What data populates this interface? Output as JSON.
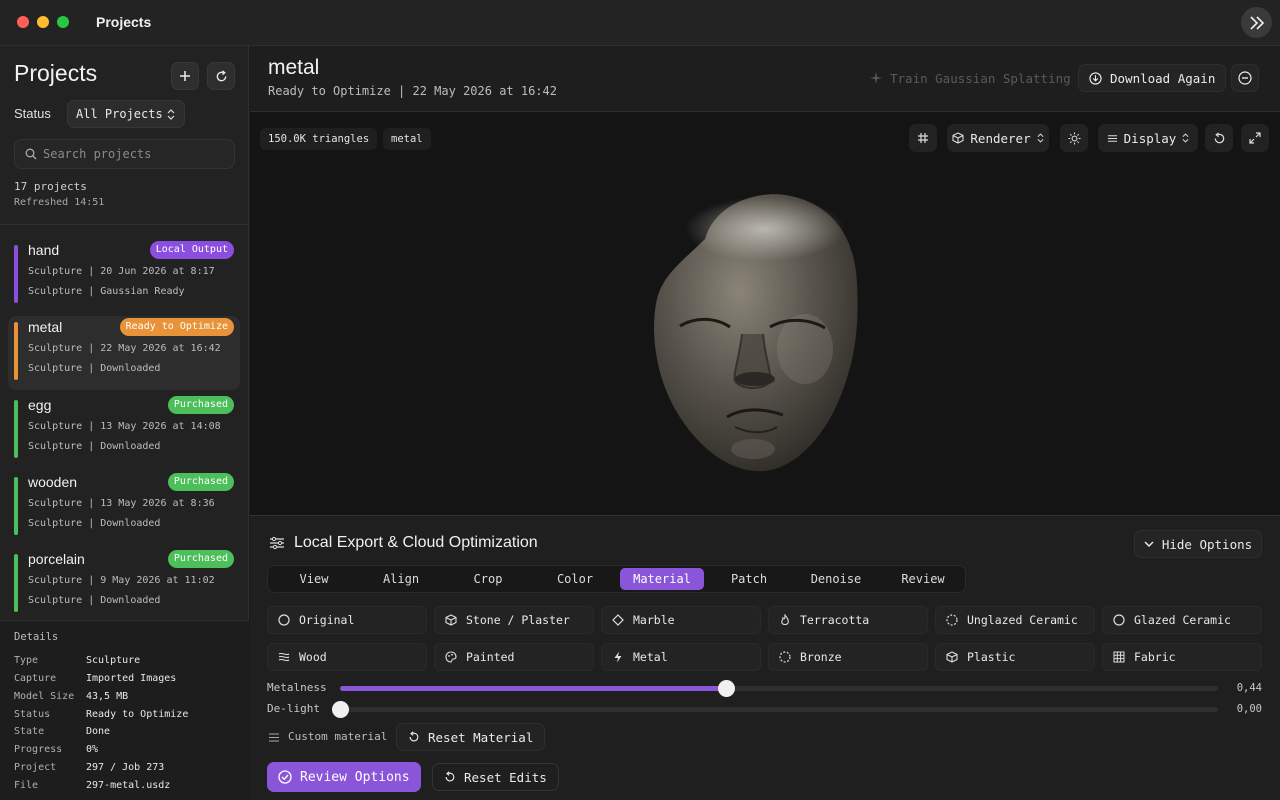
{
  "window": {
    "title": "Projects"
  },
  "sidebar": {
    "title": "Projects",
    "status_label": "Status",
    "status_value": "All Projects",
    "search_placeholder": "Search projects",
    "count": "17 projects",
    "refreshed": "Refreshed 14:51",
    "projects": [
      {
        "name": "hand",
        "badge": "Local Output",
        "badge_color": "#8b4fe0",
        "bar_color": "#8b4fe0",
        "line1": "Sculpture | 20 Jun 2026 at 8:17",
        "line2": "Sculpture | Gaussian Ready"
      },
      {
        "name": "metal",
        "badge": "Ready to Optimize",
        "badge_color": "#e8923a",
        "bar_color": "#e8923a",
        "line1": "Sculpture | 22 May 2026 at 16:42",
        "line2": "Sculpture | Downloaded"
      },
      {
        "name": "egg",
        "badge": "Purchased",
        "badge_color": "#4cbf5a",
        "bar_color": "#4cbf5a",
        "line1": "Sculpture | 13 May 2026 at 14:08",
        "line2": "Sculpture | Downloaded"
      },
      {
        "name": "wooden",
        "badge": "Purchased",
        "badge_color": "#4cbf5a",
        "bar_color": "#4cbf5a",
        "line1": "Sculpture | 13 May 2026 at 8:36",
        "line2": "Sculpture | Downloaded"
      },
      {
        "name": "porcelain",
        "badge": "Purchased",
        "badge_color": "#4cbf5a",
        "bar_color": "#4cbf5a",
        "line1": "Sculpture | 9 May 2026 at 11:02",
        "line2": "Sculpture | Downloaded"
      }
    ],
    "details": {
      "heading": "Details",
      "rows": [
        {
          "k": "Type",
          "v": "Sculpture"
        },
        {
          "k": "Capture",
          "v": "Imported Images"
        },
        {
          "k": "Model Size",
          "v": "43,5 MB"
        },
        {
          "k": "Status",
          "v": "Ready to Optimize"
        },
        {
          "k": "State",
          "v": "Done"
        },
        {
          "k": "Progress",
          "v": "0%"
        },
        {
          "k": "Project",
          "v": "297 / Job 273"
        },
        {
          "k": "File",
          "v": "297-metal.usdz"
        }
      ]
    }
  },
  "header": {
    "title": "metal",
    "subtitle": "Ready to Optimize | 22 May 2026 at 16:42",
    "train_label": "Train Gaussian Splatting",
    "download_label": "Download Again"
  },
  "viewport": {
    "triangles": "150.0K triangles",
    "material_chip": "metal",
    "renderer_label": "Renderer",
    "display_label": "Display"
  },
  "panel": {
    "title": "Local Export & Cloud Optimization",
    "hide_label": "Hide Options",
    "tabs": [
      "View",
      "Align",
      "Crop",
      "Color",
      "Material",
      "Patch",
      "Denoise",
      "Review"
    ],
    "active_tab": "Material",
    "materials": [
      {
        "label": "Original",
        "icon": "circle-icon"
      },
      {
        "label": "Stone / Plaster",
        "icon": "cube-icon"
      },
      {
        "label": "Marble",
        "icon": "diamond-icon"
      },
      {
        "label": "Terracotta",
        "icon": "flame-icon"
      },
      {
        "label": "Unglazed Ceramic",
        "icon": "dashed-circle-icon"
      },
      {
        "label": "Glazed Ceramic",
        "icon": "circle-icon"
      },
      {
        "label": "Wood",
        "icon": "wood-icon"
      },
      {
        "label": "Painted",
        "icon": "palette-icon"
      },
      {
        "label": "Metal",
        "icon": "bolt-icon"
      },
      {
        "label": "Bronze",
        "icon": "dashed-circle-icon"
      },
      {
        "label": "Plastic",
        "icon": "cube-icon"
      },
      {
        "label": "Fabric",
        "icon": "grid-icon"
      }
    ],
    "sliders": [
      {
        "label": "Metalness",
        "value": 0.44,
        "display": "0,44"
      },
      {
        "label": "De-light",
        "value": 0.0,
        "display": "0,00"
      }
    ],
    "custom_material_label": "Custom material",
    "reset_material_label": "Reset Material",
    "review_label": "Review Options",
    "reset_edits_label": "Reset Edits"
  },
  "colors": {
    "accent": "#8a55d8"
  }
}
